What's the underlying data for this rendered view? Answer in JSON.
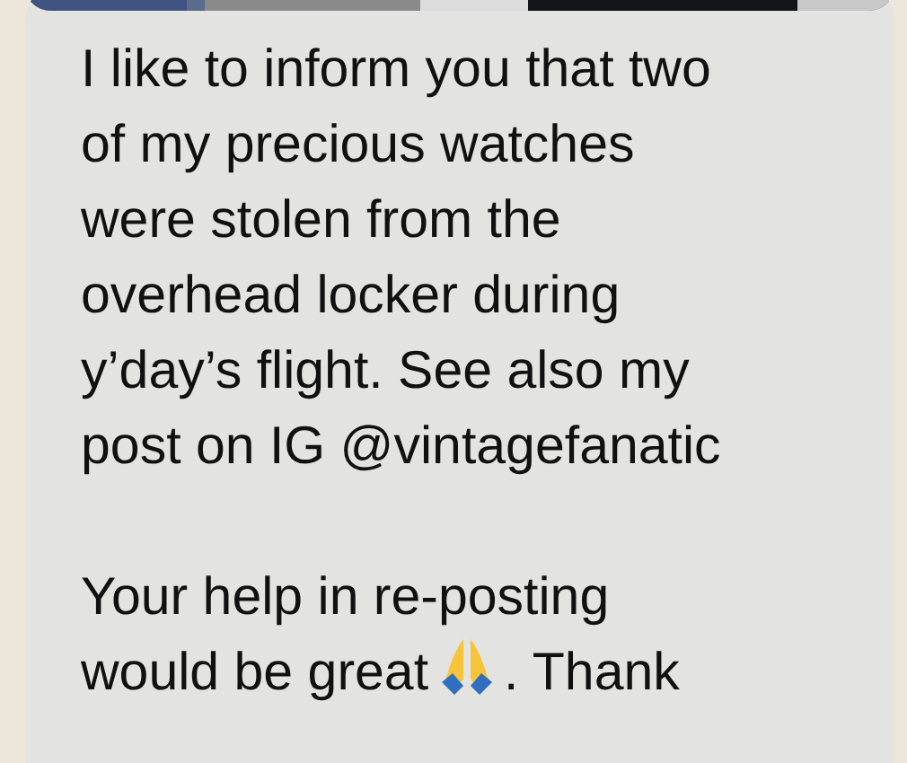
{
  "message": {
    "paragraphs": [
      {
        "lines": [
          "I like to inform you that two",
          "of my precious watches",
          "were stolen from the",
          "overhead locker during",
          "y’day’s flight. See also my",
          "post on IG @vintagefanatic"
        ]
      },
      {
        "lines": [
          "Your help in re-posting"
        ],
        "last_line": {
          "before": "would be great",
          "after": ". Thank"
        }
      }
    ]
  }
}
